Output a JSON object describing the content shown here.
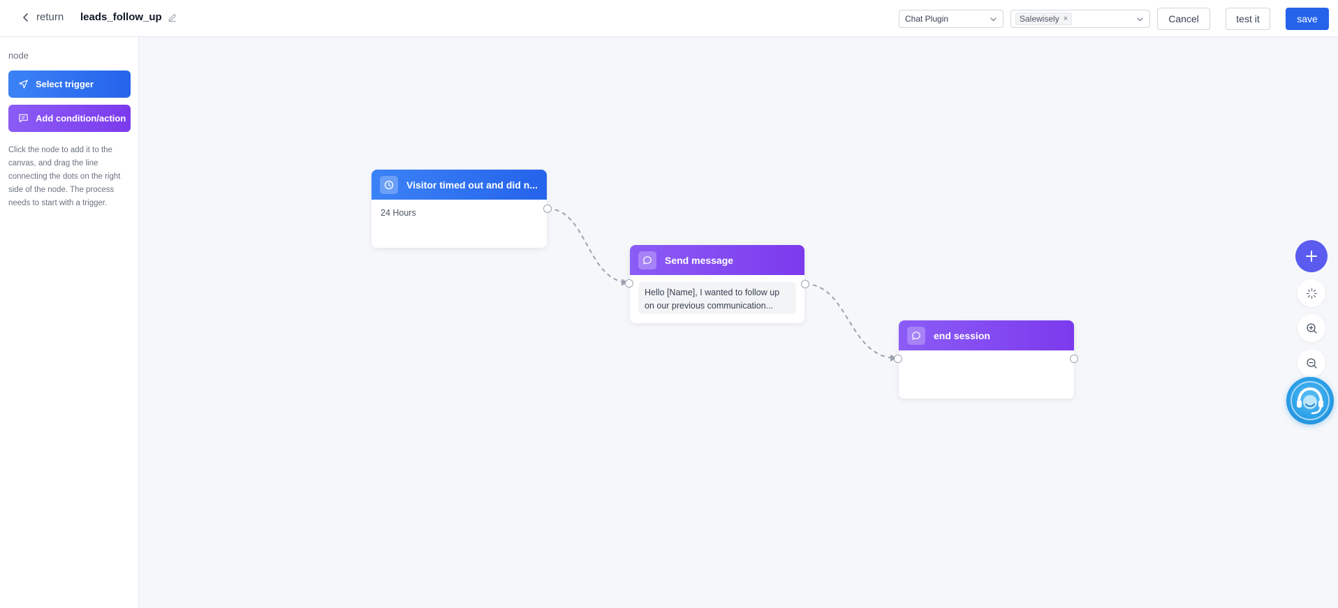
{
  "header": {
    "back_label": "return",
    "flow_name": "leads_follow_up",
    "channel_select": "Chat Plugin",
    "site_tag": "Salewisely",
    "site_tag_remove": "×",
    "cancel_label": "Cancel",
    "test_label": "test it",
    "save_label": "save"
  },
  "sidebar": {
    "title": "node",
    "trigger_button": "Select trigger",
    "action_button": "Add condition/action",
    "help_text": "Click the node to add it to the canvas, and drag the line connecting the dots on the right side of the node. The process needs to start with a trigger."
  },
  "nodes": {
    "trigger": {
      "title": "Visitor timed out and did n...",
      "detail": "24 Hours"
    },
    "send": {
      "title": "Send message",
      "message": "Hello [Name], I wanted to follow up on our previous communication..."
    },
    "end": {
      "title": "end session"
    }
  },
  "colors": {
    "primary": "#2563eb",
    "trigger_blue": "#3b82f6",
    "action_purple": "#7c3aed",
    "add_tool": "#5b5bf0",
    "support": "#2aa0e8"
  },
  "icons": {
    "back": "chevron-left-icon",
    "edit": "pencil-icon",
    "trigger": "navigation-arrow-icon",
    "action": "message-square-icon",
    "clock": "clock-icon",
    "chat": "chat-bubble-icon",
    "add": "plus-icon",
    "layout": "auto-layout-icon",
    "zoom_in": "zoom-in-icon",
    "zoom_out": "zoom-out-icon",
    "support": "headset-support-icon"
  }
}
